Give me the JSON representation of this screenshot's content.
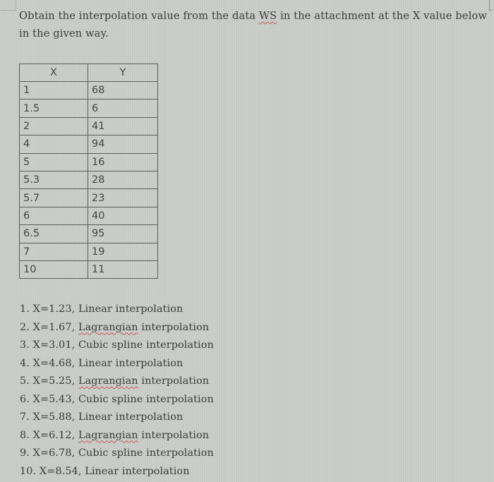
{
  "prompt": {
    "line1_before": "Obtain the interpolation value from the data ",
    "ws_word": "WS",
    "line1_after": " in the attachment at the X value below in the given way."
  },
  "table": {
    "headers": [
      "X",
      "Y"
    ],
    "rows": [
      {
        "x": "1",
        "y": "68"
      },
      {
        "x": "1.5",
        "y": "6"
      },
      {
        "x": "2",
        "y": "41"
      },
      {
        "x": "4",
        "y": "94"
      },
      {
        "x": "5",
        "y": "16"
      },
      {
        "x": "5.3",
        "y": "28"
      },
      {
        "x": "5.7",
        "y": "23"
      },
      {
        "x": "6",
        "y": "40"
      },
      {
        "x": "6.5",
        "y": "95"
      },
      {
        "x": "7",
        "y": "19"
      },
      {
        "x": "10",
        "y": "11"
      }
    ]
  },
  "tasks": [
    {
      "num": "1.",
      "x": "X=1.23,",
      "method_a": "Linear",
      "method_b": "interpolation"
    },
    {
      "num": "2.",
      "x": "X=1.67,",
      "method_a": "Lagrangian",
      "method_b": "interpolation"
    },
    {
      "num": "3.",
      "x": "X=3.01,",
      "method_a": "Cubic spline",
      "method_b": "interpolation"
    },
    {
      "num": "4.",
      "x": "X=4.68,",
      "method_a": "Linear",
      "method_b": "interpolation"
    },
    {
      "num": "5.",
      "x": "X=5.25,",
      "method_a": "Lagrangian",
      "method_b": "interpolation"
    },
    {
      "num": "6.",
      "x": "X=5.43,",
      "method_a": "Cubic spline",
      "method_b": "interpolation"
    },
    {
      "num": "7.",
      "x": "X=5.88,",
      "method_a": "Linear",
      "method_b": "interpolation"
    },
    {
      "num": "8.",
      "x": "X=6.12,",
      "method_a": "Lagrangian",
      "method_b": "interpolation"
    },
    {
      "num": "9.",
      "x": "X=6.78,",
      "method_a": "Cubic spline",
      "method_b": "interpolation"
    },
    {
      "num": "10.",
      "x": "X=8.54,",
      "method_a": "Linear",
      "method_b": "interpolation"
    }
  ]
}
